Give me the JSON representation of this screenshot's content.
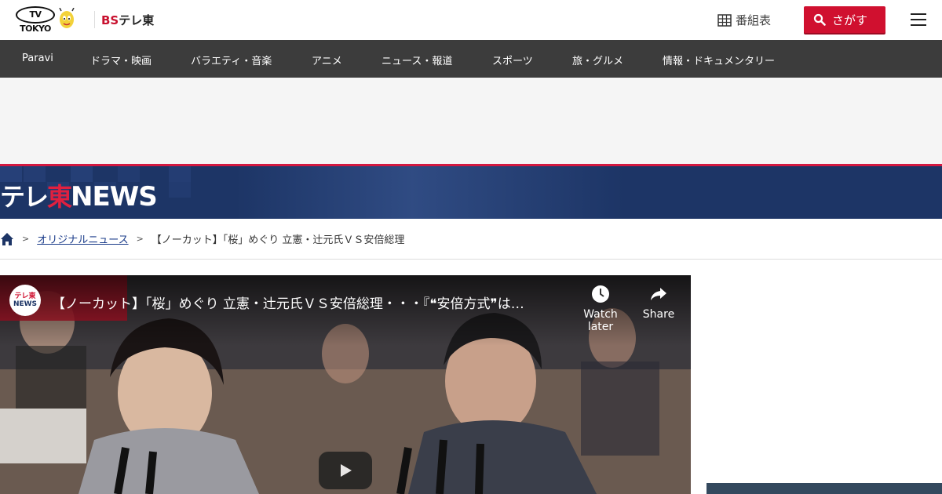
{
  "header": {
    "logo_tvtokyo": "TV TOKYO",
    "logo_bs_prefix": "BS",
    "logo_bs_suffix": "テレ東",
    "tvguide_label": "番組表",
    "search_label": "さがす"
  },
  "nav": {
    "items": [
      {
        "label": "Paravi"
      },
      {
        "label": "ドラマ・映画"
      },
      {
        "label": "バラエティ・音楽"
      },
      {
        "label": "アニメ"
      },
      {
        "label": "ニュース・報道"
      },
      {
        "label": "スポーツ"
      },
      {
        "label": "旅・グルメ"
      },
      {
        "label": "情報・ドキュメンタリー"
      }
    ]
  },
  "banner": {
    "logo_jp_1": "テレ",
    "logo_jp_2": "東",
    "logo_en": "NEWS"
  },
  "breadcrumb": {
    "items": [
      {
        "label": "オリジナルニュース"
      },
      {
        "label": "【ノーカット】「桜」めぐり 立憲・辻元氏ＶＳ安倍総理"
      }
    ]
  },
  "video": {
    "channel_line1": "テレ東",
    "channel_line2": "NEWS",
    "title": "【ノーカット】「桜」めぐり 立憲・辻元氏ＶＳ安倍総理・・・『❝安倍方式❞は…",
    "watch_later": "Watch later",
    "share": "Share",
    "overlay_text": "ノーカット"
  },
  "colors": {
    "accent_red": "#d0102f",
    "nav_bg": "#3c3c3c",
    "banner_bg": "#1d3566"
  }
}
